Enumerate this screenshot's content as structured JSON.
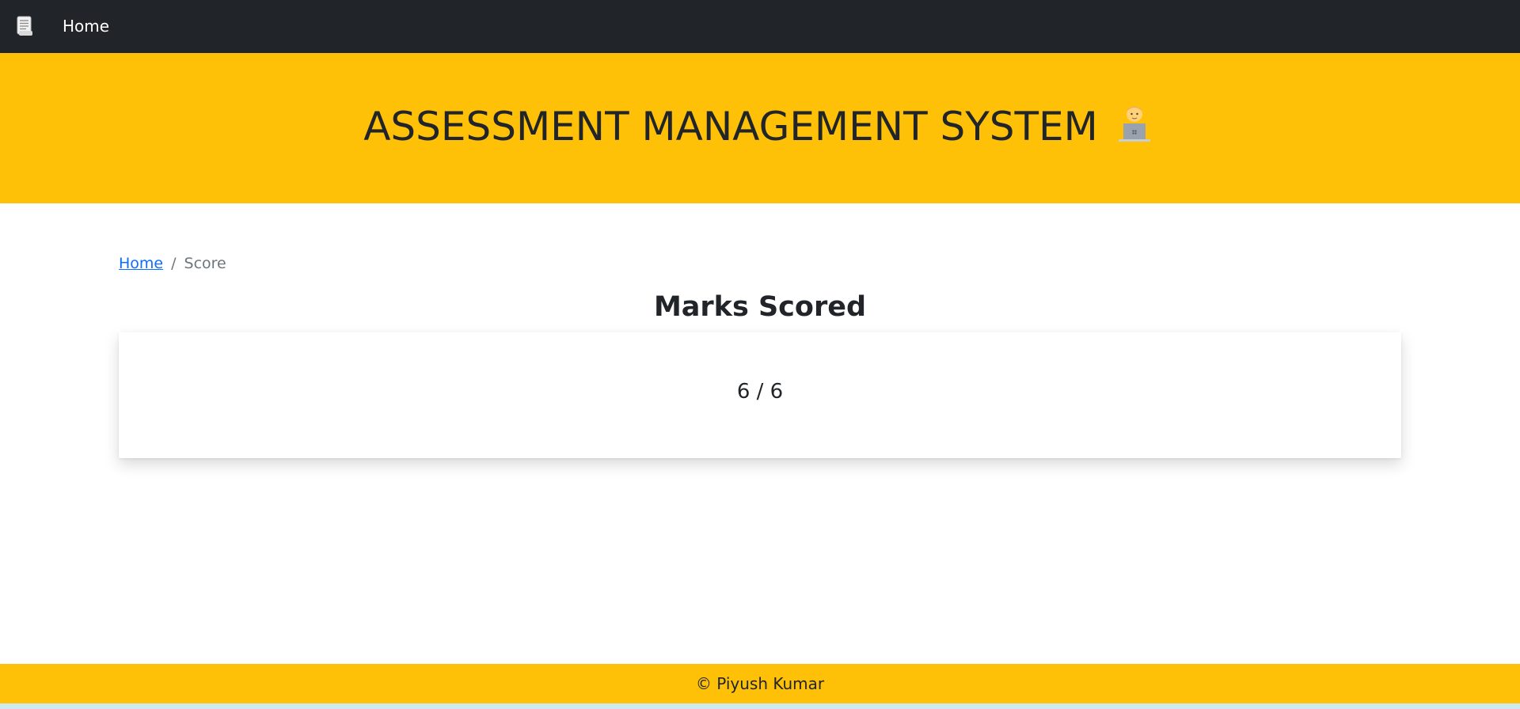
{
  "navbar": {
    "logo_icon": "scroll-document-icon",
    "home_label": "Home",
    "background": "#212529"
  },
  "hero": {
    "title": "ASSESSMENT MANAGEMENT SYSTEM",
    "emoji_icon": "person-at-laptop-icon",
    "background": "#ffc107"
  },
  "breadcrumb": {
    "home_label": "Home",
    "separator": "/",
    "current_label": "Score"
  },
  "main": {
    "section_title": "Marks Scored",
    "score": "6 / 6"
  },
  "footer": {
    "text": "© Piyush Kumar",
    "background": "#ffc107"
  }
}
